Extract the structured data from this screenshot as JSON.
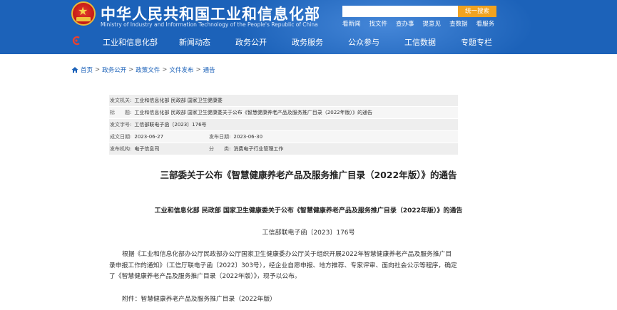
{
  "header": {
    "title": "中华人民共和国工业和信息化部",
    "subtitle": "Ministry of Industry and Information Technology of the People's Republic of China",
    "search": {
      "placeholder": "",
      "button_label": "统一搜索"
    },
    "quick_links": [
      "看新闻",
      "找文件",
      "查办事",
      "提意见",
      "查数据",
      "看服务"
    ]
  },
  "nav": {
    "items": [
      "工业和信息化部",
      "新闻动态",
      "政务公开",
      "政务服务",
      "公众参与",
      "工信数据",
      "专题专栏"
    ]
  },
  "breadcrumb": [
    "首页",
    "政务公开",
    "政策文件",
    "文件发布",
    "通告"
  ],
  "meta": {
    "issuer_label": "发文机关:",
    "issuer": "工业和信息化部 民政部 国家卫生健康委",
    "title_label": "标　　题:",
    "title": "工业和信息化部 民政部 国家卫生健康委关于公布《智慧健康养老产品及服务推广目录（2022年版）》的通告",
    "doc_no_label": "发文字号:",
    "doc_no": "工信部联电子函〔2023〕176号",
    "created_label": "成文日期:",
    "created": "2023-06-27",
    "published_label": "发布日期:",
    "published": "2023-06-30",
    "org_label": "发布机构:",
    "org": "电子信息司",
    "category_label": "分　　类:",
    "category": "消费电子行业管理工作"
  },
  "article": {
    "title": "三部委关于公布《智慧健康养老产品及服务推广目录（2022年版）》的通告",
    "subtitle": "工业和信息化部  民政部  国家卫生健康委关于公布《智慧健康养老产品及服务推广目录（2022年版）》的通告",
    "doc_number": "工信部联电子函〔2023〕176号",
    "body": "根据《工业和信息化部办公厅民政部办公厅国家卫生健康委办公厅关于组织开展2022年智慧健康养老产品及服务推广目录申报工作的通知》（工信厅联电子函〔2022〕303号），经企业自愿申报、地方推荐、专家评审、面向社会公示等程序，确定了《智慧健康养老产品及服务推广目录（2022年版）》，现予以公布。",
    "attachment": "附件：智慧健康养老产品及服务推广目录（2022年版）"
  },
  "colors": {
    "header_blue": "#1c62b9",
    "search_orange": "#f0a321",
    "link_blue": "#1c62b9"
  }
}
